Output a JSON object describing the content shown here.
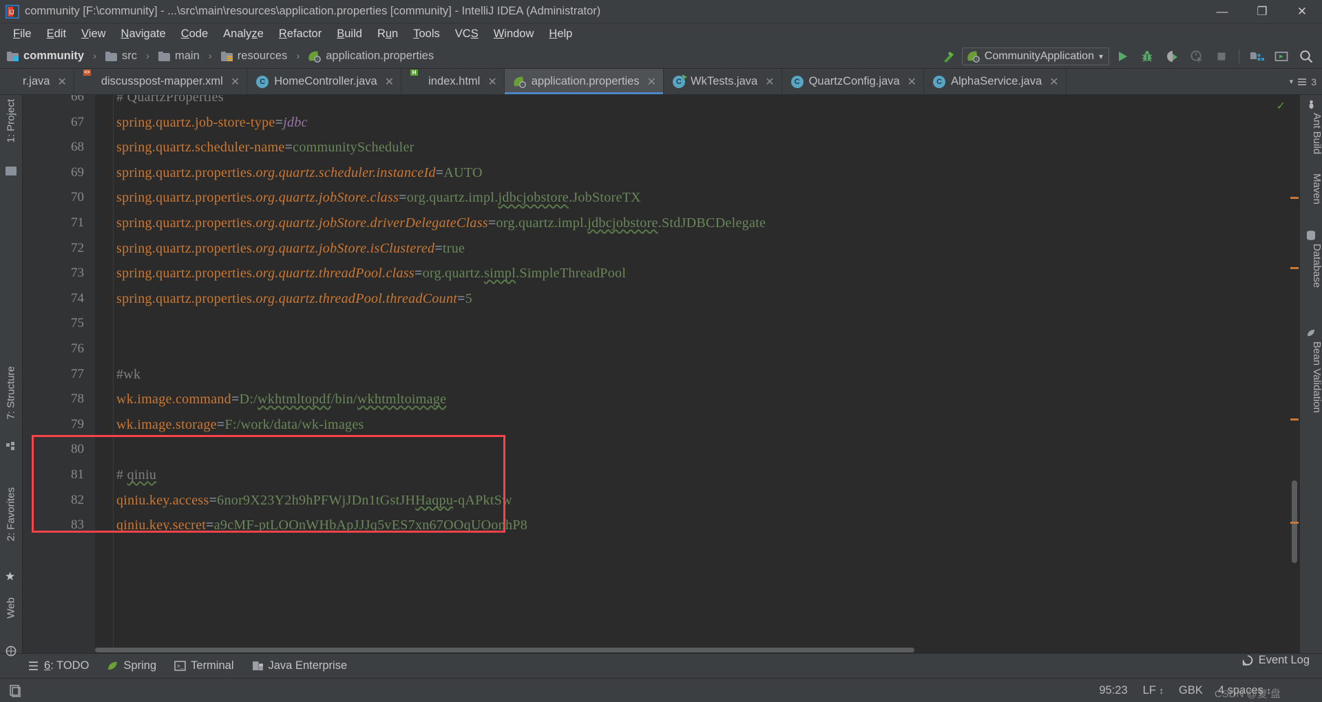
{
  "window": {
    "title": "community [F:\\community] - ...\\src\\main\\resources\\application.properties [community] - IntelliJ IDEA (Administrator)",
    "app_icon": "intellij-idea-logo",
    "minimize": "—",
    "maximize": "❐",
    "close": "✕"
  },
  "menubar": {
    "items": [
      {
        "label": "File",
        "mnemonic": "F"
      },
      {
        "label": "Edit",
        "mnemonic": "E"
      },
      {
        "label": "View",
        "mnemonic": "V"
      },
      {
        "label": "Navigate",
        "mnemonic": "N"
      },
      {
        "label": "Code",
        "mnemonic": "C"
      },
      {
        "label": "Analyze",
        "mnemonic": "z"
      },
      {
        "label": "Refactor",
        "mnemonic": "R"
      },
      {
        "label": "Build",
        "mnemonic": "B"
      },
      {
        "label": "Run",
        "mnemonic": "u"
      },
      {
        "label": "Tools",
        "mnemonic": "T"
      },
      {
        "label": "VCS",
        "mnemonic": "S"
      },
      {
        "label": "Window",
        "mnemonic": "W"
      },
      {
        "label": "Help",
        "mnemonic": "H"
      }
    ]
  },
  "breadcrumb": {
    "items": [
      {
        "label": "community",
        "icon": "module-folder-icon"
      },
      {
        "label": "src",
        "icon": "folder-icon"
      },
      {
        "label": "main",
        "icon": "folder-icon"
      },
      {
        "label": "resources",
        "icon": "resources-folder-icon"
      },
      {
        "label": "application.properties",
        "icon": "spring-properties-icon"
      }
    ],
    "separator": "›"
  },
  "toolbar": {
    "build_icon": "hammer-icon",
    "run_config": {
      "label": "CommunityApplication",
      "icon": "spring-boot-icon",
      "arrow": "▾"
    },
    "buttons": [
      {
        "name": "run-button",
        "icon": "play-triangle"
      },
      {
        "name": "debug-button",
        "icon": "bug-icon"
      },
      {
        "name": "run-with-coverage-button",
        "icon": "coverage-icon"
      },
      {
        "name": "profile-button",
        "icon": "profiler-icon"
      },
      {
        "name": "stop-button",
        "icon": "stop-square"
      },
      {
        "name": "project-structure-button",
        "icon": "project-structure-icon"
      },
      {
        "name": "update-button",
        "icon": "update-app-icon"
      },
      {
        "name": "search-everywhere-button",
        "icon": "search-icon"
      }
    ]
  },
  "tabs": {
    "items": [
      {
        "label": "r.java",
        "icon": "java-class-icon",
        "active": false,
        "truncated": true
      },
      {
        "label": "discusspost-mapper.xml",
        "icon": "xml-file-icon",
        "active": false
      },
      {
        "label": "HomeController.java",
        "icon": "java-class-icon",
        "active": false
      },
      {
        "label": "index.html",
        "icon": "html-file-icon",
        "active": false
      },
      {
        "label": "application.properties",
        "icon": "spring-properties-icon",
        "active": true
      },
      {
        "label": "WkTests.java",
        "icon": "java-test-class-icon",
        "active": false
      },
      {
        "label": "QuartzConfig.java",
        "icon": "java-class-icon",
        "active": false
      },
      {
        "label": "AlphaService.java",
        "icon": "java-class-icon",
        "active": false
      }
    ],
    "close_glyph": "✕",
    "overflow_count": "3",
    "overflow_arrow": "▾"
  },
  "left_toolwindows": [
    {
      "label": "1: Project",
      "icon": "project-folder-icon"
    },
    {
      "label": "7: Structure",
      "icon": "structure-icon"
    },
    {
      "label": "2: Favorites",
      "icon": "star-icon"
    },
    {
      "label": "Web",
      "icon": "web-icon"
    }
  ],
  "right_toolwindows": [
    {
      "label": "Ant Build",
      "icon": "ant-icon"
    },
    {
      "label": "Maven",
      "icon": "maven-icon"
    },
    {
      "label": "Database",
      "icon": "database-icon"
    },
    {
      "label": "Bean Validation",
      "icon": "bean-validation-icon"
    }
  ],
  "editor": {
    "first_visible_line": 66,
    "inspection_status": "✓",
    "lines": [
      {
        "num": 66,
        "clipped": true,
        "tokens": [
          {
            "t": "# QuartzProperties",
            "c": "cmt"
          }
        ]
      },
      {
        "num": 67,
        "tokens": [
          {
            "t": "spring.quartz.job-store-type",
            "c": "k"
          },
          {
            "t": "=",
            "c": "sep"
          },
          {
            "t": "jdbc",
            "c": "kw"
          }
        ]
      },
      {
        "num": 68,
        "tokens": [
          {
            "t": "spring.quartz.scheduler-name",
            "c": "k"
          },
          {
            "t": "=",
            "c": "sep"
          },
          {
            "t": "communityScheduler",
            "c": "v"
          }
        ]
      },
      {
        "num": 69,
        "tokens": [
          {
            "t": "spring.quartz.properties.",
            "c": "k"
          },
          {
            "t": "org.quartz.scheduler.instanceId",
            "c": "ki"
          },
          {
            "t": "=",
            "c": "sep"
          },
          {
            "t": "AUTO",
            "c": "v"
          }
        ]
      },
      {
        "num": 70,
        "tokens": [
          {
            "t": "spring.quartz.properties.",
            "c": "k"
          },
          {
            "t": "org.quartz.jobStore.class",
            "c": "ki"
          },
          {
            "t": "=",
            "c": "sep"
          },
          {
            "t": "org.quartz.impl.",
            "c": "v"
          },
          {
            "t": "jdbcjobstore",
            "c": "v squig"
          },
          {
            "t": ".JobStoreTX",
            "c": "v"
          }
        ]
      },
      {
        "num": 71,
        "tokens": [
          {
            "t": "spring.quartz.properties.",
            "c": "k"
          },
          {
            "t": "org.quartz.jobStore.driverDelegateClass",
            "c": "ki"
          },
          {
            "t": "=",
            "c": "sep"
          },
          {
            "t": "org.quartz.impl.",
            "c": "v"
          },
          {
            "t": "jdbcjobstore",
            "c": "v squig"
          },
          {
            "t": ".StdJDBCDelegate",
            "c": "v"
          }
        ]
      },
      {
        "num": 72,
        "tokens": [
          {
            "t": "spring.quartz.properties.",
            "c": "k"
          },
          {
            "t": "org.quartz.jobStore.isClustered",
            "c": "ki"
          },
          {
            "t": "=",
            "c": "sep"
          },
          {
            "t": "true",
            "c": "v"
          }
        ]
      },
      {
        "num": 73,
        "tokens": [
          {
            "t": "spring.quartz.properties.",
            "c": "k"
          },
          {
            "t": "org.quartz.threadPool.class",
            "c": "ki"
          },
          {
            "t": "=",
            "c": "sep"
          },
          {
            "t": "org.quartz.",
            "c": "v"
          },
          {
            "t": "simpl",
            "c": "v squig"
          },
          {
            "t": ".SimpleThreadPool",
            "c": "v"
          }
        ]
      },
      {
        "num": 74,
        "tokens": [
          {
            "t": "spring.quartz.properties.",
            "c": "k"
          },
          {
            "t": "org.quartz.threadPool.threadCount",
            "c": "ki"
          },
          {
            "t": "=",
            "c": "sep"
          },
          {
            "t": "5",
            "c": "v"
          }
        ]
      },
      {
        "num": 75,
        "tokens": []
      },
      {
        "num": 76,
        "tokens": []
      },
      {
        "num": 77,
        "tokens": [
          {
            "t": "#wk",
            "c": "cmt"
          }
        ]
      },
      {
        "num": 78,
        "tokens": [
          {
            "t": "wk.image.command",
            "c": "k"
          },
          {
            "t": "=",
            "c": "sep"
          },
          {
            "t": "D:/",
            "c": "v"
          },
          {
            "t": "wkhtmltopdf",
            "c": "v squig"
          },
          {
            "t": "/bin/",
            "c": "v"
          },
          {
            "t": "wkhtmltoimage",
            "c": "v squig"
          }
        ]
      },
      {
        "num": 79,
        "tokens": [
          {
            "t": "wk.image.storage",
            "c": "k"
          },
          {
            "t": "=",
            "c": "sep"
          },
          {
            "t": "F:/work/data/wk-images",
            "c": "v"
          }
        ]
      },
      {
        "num": 80,
        "tokens": []
      },
      {
        "num": 81,
        "tokens": [
          {
            "t": "# ",
            "c": "cmt"
          },
          {
            "t": "qiniu",
            "c": "cmt squig"
          }
        ]
      },
      {
        "num": 82,
        "tokens": [
          {
            "t": "qiniu.key.access",
            "c": "k"
          },
          {
            "t": "=",
            "c": "sep"
          },
          {
            "t": "6nor9X23Y2h9hPFWjJDn1tGstJH",
            "c": "v"
          },
          {
            "t": "Haqpu",
            "c": "v squig"
          },
          {
            "t": "-qAPktSw",
            "c": "v"
          }
        ]
      },
      {
        "num": 83,
        "tokens": [
          {
            "t": "qiniu.key.secret",
            "c": "k"
          },
          {
            "t": "=",
            "c": "sep"
          },
          {
            "t": "a9cMF-ptLOOnWHbApJJJq5vES7xn67OOqUOonhP8",
            "c": "v"
          }
        ]
      }
    ],
    "highlight_box": {
      "color": "#f9434a",
      "label": "wk-config-highlight"
    }
  },
  "tool_windows_bar": [
    {
      "label": "6: TODO",
      "icon": "todo-list-icon",
      "mnemonic": "6"
    },
    {
      "label": "Spring",
      "icon": "spring-leaf-icon"
    },
    {
      "label": "Terminal",
      "icon": "terminal-icon"
    },
    {
      "label": "Java Enterprise",
      "icon": "java-enterprise-icon"
    }
  ],
  "statusbar": {
    "event_log": {
      "label": "Event Log",
      "icon": "event-log-icon"
    },
    "caret_position": "95:23",
    "line_separator": "LF",
    "encoding": "GBK",
    "indent": "4 spaces",
    "updown_glyph": "↕",
    "watermark": "CSDN @复 盘"
  }
}
